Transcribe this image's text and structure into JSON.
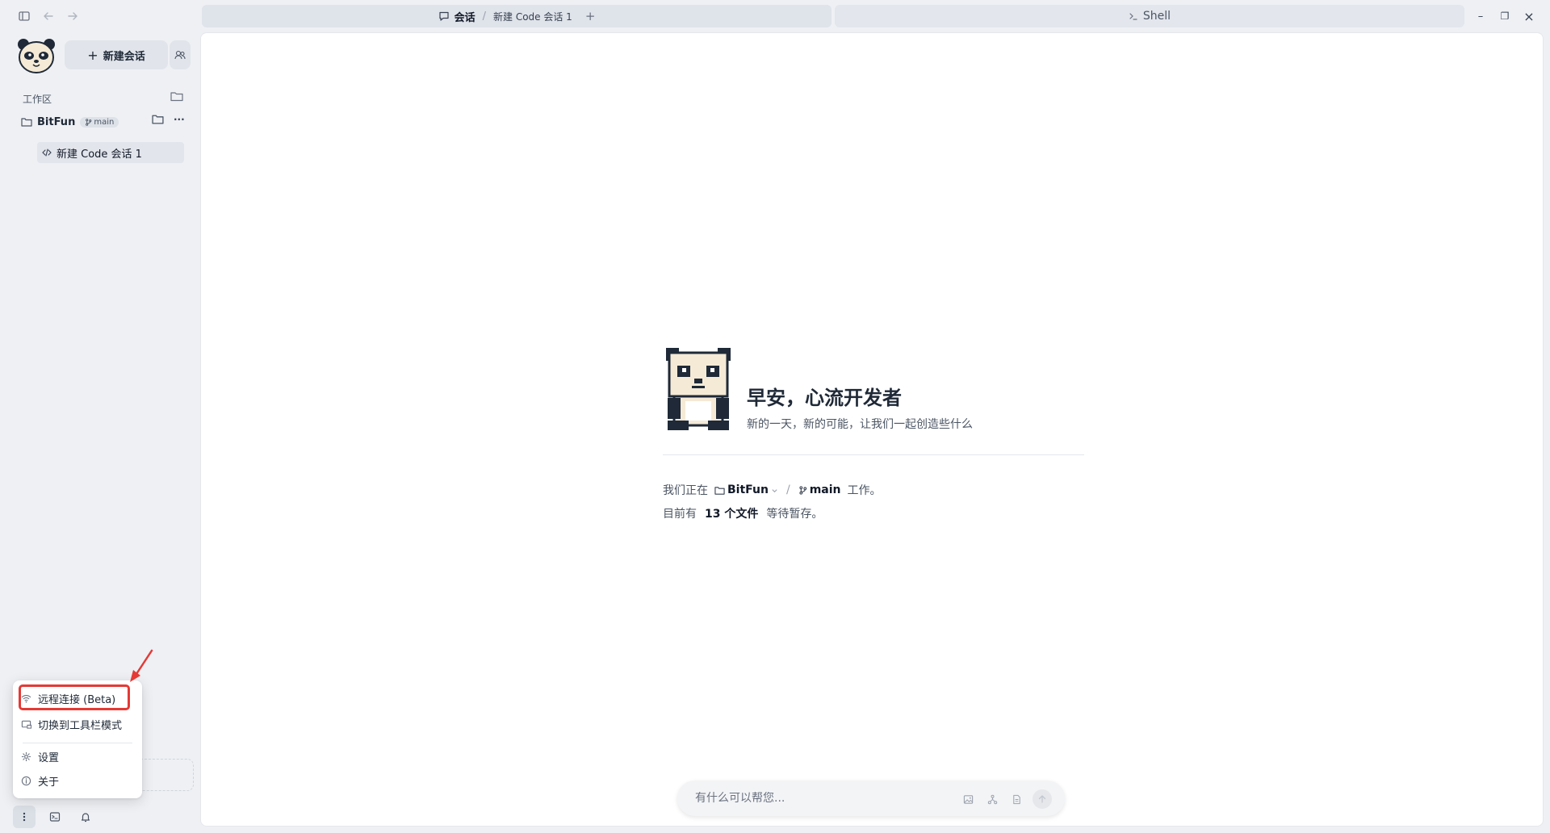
{
  "titlebar": {
    "chat_tab": {
      "section_label": "会话",
      "separator": "/",
      "session_label": "新建 Code 会话 1",
      "add_symbol": "+"
    },
    "shell_tab": {
      "label": "Shell"
    },
    "window_controls": {
      "minimize": "–",
      "restore": "❐",
      "close": "×"
    }
  },
  "sidebar": {
    "new_chat_label": "新建会话",
    "workspace_label": "工作区",
    "project": {
      "name": "BitFun",
      "branch": "main",
      "more": "···"
    },
    "sessions": [
      {
        "label": "新建 Code 会话 1"
      }
    ]
  },
  "menu": {
    "items": [
      {
        "label": "远程连接 (Beta)",
        "icon": "wifi-icon"
      },
      {
        "label": "切换到工具栏模式",
        "icon": "toolbar-icon"
      },
      {
        "label": "设置",
        "icon": "gear-icon"
      },
      {
        "label": "关于",
        "icon": "info-icon"
      }
    ]
  },
  "main": {
    "greeting": "早安，心流开发者",
    "subtitle": "新的一天，新的可能，让我们一起创造些什么",
    "status": {
      "working_prefix": "我们正在",
      "project": "BitFun",
      "separator": "/",
      "branch": "main",
      "working_suffix": "工作。",
      "files_prefix": "目前有",
      "files_count": "13 个文件",
      "files_suffix": "等待暂存。"
    },
    "chat_input": {
      "placeholder": "有什么可以帮您..."
    }
  },
  "colors": {
    "accent_red": "#e53935",
    "sidebar_bg": "#eef0f4",
    "main_bg": "#ffffff"
  }
}
